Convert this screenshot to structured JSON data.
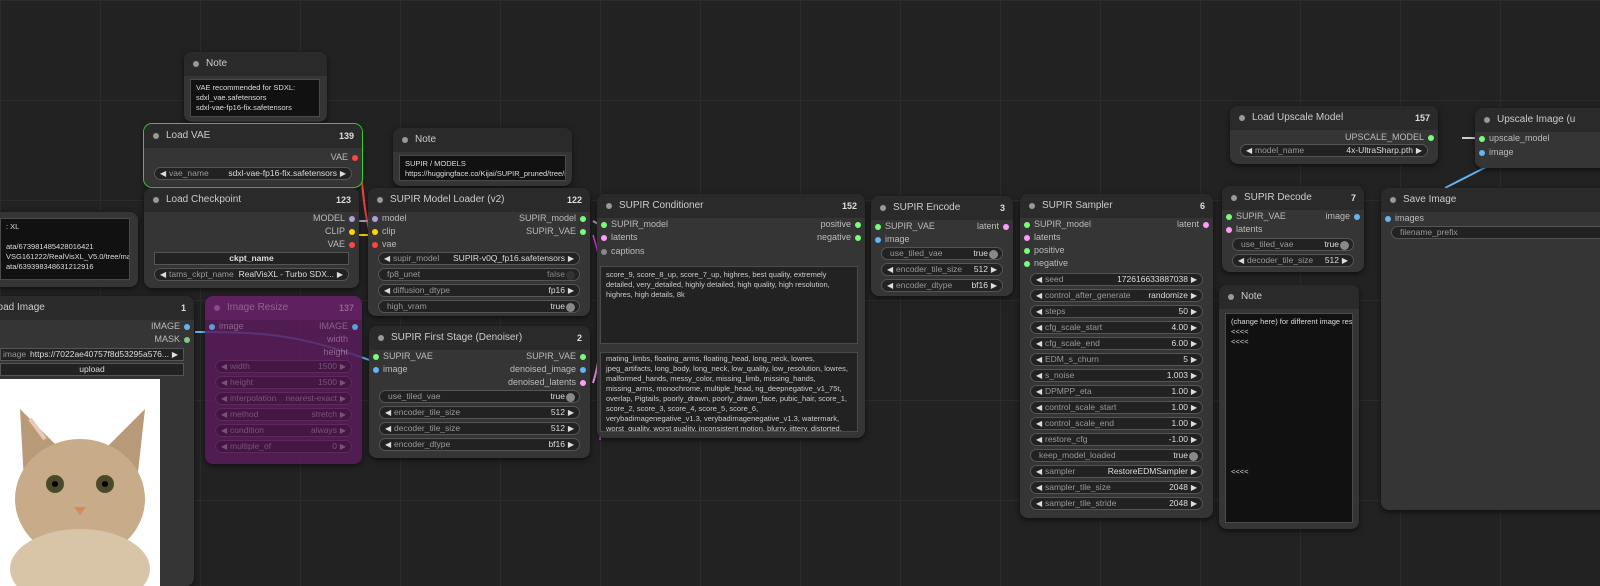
{
  "nodes": {
    "note1": {
      "title": "Note",
      "text": "VAE recommended for SDXL:\nsdxl_vae.safetensors\nsdxl-vae-fp16-fix.safetensors"
    },
    "load_vae": {
      "title": "Load VAE",
      "id": "139",
      "out": "VAE",
      "w_name": "vae_name",
      "w_val": "sdxl-vae-fp16-fix.safetensors"
    },
    "note2": {
      "title": "Note",
      "text": "SUPIR / MODELS\nhttps://huggingface.co/Kijai/SUPIR_pruned/tree/main"
    },
    "partial_note": {
      "lines": [
        ": XL",
        "",
        "ata/67398148542801642​1",
        "VSG161222/RealVisXL_V5.0/tree/main",
        "ata/6393983486312129​16"
      ]
    },
    "load_ckpt": {
      "title": "Load Checkpoint",
      "id": "123",
      "outs": [
        "MODEL",
        "CLIP",
        "VAE"
      ],
      "w0": "ckpt_name",
      "w1_name": "tams_ckpt_name",
      "w1_val": "RealVisXL - Turbo SDX..."
    },
    "load_image": {
      "title": "Load Image",
      "id": "1",
      "outs": [
        "IMAGE",
        "MASK"
      ],
      "w_name": "image",
      "w_val": "https://7022ae40757f8d53295a576...",
      "upload": "upload"
    },
    "image_resize": {
      "title": "Image Resize",
      "id": "137",
      "in": "image",
      "outs": [
        "IMAGE",
        "width",
        "height"
      ],
      "widgets": [
        [
          "width",
          "1500"
        ],
        [
          "height",
          "1500"
        ],
        [
          "interpolation",
          "nearest-exact"
        ],
        [
          "method",
          "stretch"
        ],
        [
          "condition",
          "always"
        ],
        [
          "multiple_of",
          "0"
        ]
      ]
    },
    "supir_loader": {
      "title": "SUPIR Model Loader (v2)",
      "id": "122",
      "ins": [
        "model",
        "clip",
        "vae"
      ],
      "outs": [
        "SUPIR_model",
        "SUPIR_VAE"
      ],
      "widgets": [
        [
          "supir_model",
          "SUPIR-v0Q_fp16.safetensors"
        ],
        [
          "fp8_unet",
          "false"
        ],
        [
          "diffusion_dtype",
          "fp16"
        ],
        [
          "high_vram",
          "true"
        ]
      ]
    },
    "first_stage": {
      "title": "SUPIR First Stage (Denoiser)",
      "id": "2",
      "ins": [
        "SUPIR_VAE",
        "image"
      ],
      "outs": [
        "SUPIR_VAE",
        "denoised_image",
        "denoised_latents"
      ],
      "widgets": [
        [
          "use_tiled_vae",
          "true"
        ],
        [
          "encoder_tile_size",
          "512"
        ],
        [
          "decoder_tile_size",
          "512"
        ],
        [
          "encoder_dtype",
          "bf16"
        ]
      ]
    },
    "conditioner": {
      "title": "SUPIR Conditioner",
      "id": "152",
      "ins": [
        "SUPIR_model",
        "latents",
        "captions"
      ],
      "outs": [
        "positive",
        "negative"
      ],
      "pos_text": "score_9, score_8_up, score_7_up, highres, best quality, extremely detailed, very_detailed, highly detailed, high quality, high resolution, highres, high details, 8k",
      "neg_text": "mating_limbs, floating_arms, floating_head, long_neck, lowres, jpeg_artifacts, long_body, long_neck, low_quality, low_resolution, lowres, malformed_hands, messy_color, missing_limb, missing_hands, missing_arms, monochrome, multiple_head, ng_deepnegative_v1_75t, overlap, Pigtails, poorly_drawn, poorly_drawn_face, pubic_hair, score_1, score_2, score_3, score_4, score_5, score_6, verybadimagenegative_v1.3, verybadimagenegative_v1.3, watermark, worst_quality, worst quality, inconsistent motion, blurry, jittery, distorted, watermarks, 3d,"
    },
    "encode": {
      "title": "SUPIR Encode",
      "id": "3",
      "ins": [
        "SUPIR_VAE",
        "image"
      ],
      "out": "latent",
      "widgets": [
        [
          "use_tiled_vae",
          "true"
        ],
        [
          "encoder_tile_size",
          "512"
        ],
        [
          "encoder_dtype",
          "bf16"
        ]
      ]
    },
    "sampler": {
      "title": "SUPIR Sampler",
      "id": "6",
      "ins": [
        "SUPIR_model",
        "latents",
        "positive",
        "negative"
      ],
      "out": "latent",
      "widgets": [
        [
          "seed",
          "172616633887038"
        ],
        [
          "control_after_generate",
          "randomize"
        ],
        [
          "steps",
          "50"
        ],
        [
          "cfg_scale_start",
          "4.00"
        ],
        [
          "cfg_scale_end",
          "6.00"
        ],
        [
          "EDM_s_churn",
          "5"
        ],
        [
          "s_noise",
          "1.003"
        ],
        [
          "DPMPP_eta",
          "1.00"
        ],
        [
          "control_scale_start",
          "1.00"
        ],
        [
          "control_scale_end",
          "1.00"
        ],
        [
          "restore_cfg",
          "-1.00"
        ],
        [
          "keep_model_loaded",
          "true"
        ],
        [
          "sampler",
          "RestoreEDMSampler"
        ],
        [
          "sampler_tile_size",
          "2048"
        ],
        [
          "sampler_tile_stride",
          "2048"
        ]
      ]
    },
    "decode": {
      "title": "SUPIR Decode",
      "id": "7",
      "ins": [
        "SUPIR_VAE",
        "latents"
      ],
      "out": "image",
      "widgets": [
        [
          "use_tiled_vae",
          "true"
        ],
        [
          "decoder_tile_size",
          "512"
        ]
      ]
    },
    "note3": {
      "title": "Note",
      "text": "(change here) for different image results\n<<<<\n<<<<\n\n\n\n\n\n\n\n\n\n\n\n\n<<<<"
    },
    "upscale_model": {
      "title": "Load Upscale Model",
      "id": "157",
      "out": "UPSCALE_MODEL",
      "w_name": "model_name",
      "w_val": "4x-UltraSharp.pth"
    },
    "upscale_image": {
      "title": "Upscale Image (u",
      "ins": [
        "upscale_model",
        "image"
      ]
    },
    "save_image": {
      "title": "Save Image",
      "in": "images",
      "w": "filename_prefix"
    }
  }
}
